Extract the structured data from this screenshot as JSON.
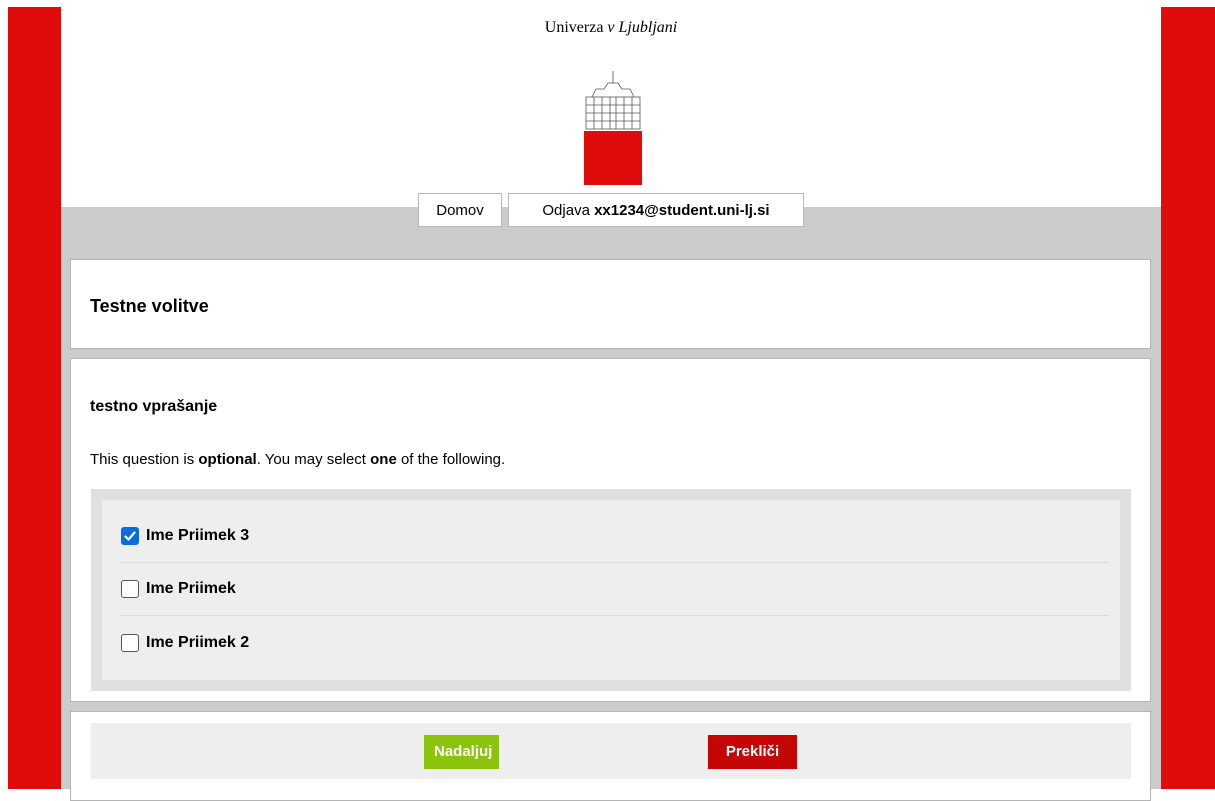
{
  "header": {
    "university_prefix": "Univerza",
    "university_italic": "v Ljubljani",
    "logo": "university-building-logo"
  },
  "nav": {
    "home_label": "Domov",
    "logout_label": "Odjava",
    "user_email": "xx1234@student.uni-lj.si"
  },
  "election": {
    "title": "Testne volitve"
  },
  "question": {
    "title": "testno vprašanje",
    "instructions": {
      "part1": "This question is ",
      "optional": "optional",
      "part2": ". You may select ",
      "count": "one",
      "part3": " of the following."
    },
    "options": [
      {
        "label": "Ime Priimek 3",
        "checked": true
      },
      {
        "label": "Ime Priimek",
        "checked": false
      },
      {
        "label": "Ime Priimek 2",
        "checked": false
      }
    ]
  },
  "actions": {
    "continue_label": "Nadaljuj",
    "cancel_label": "Prekliči"
  },
  "colors": {
    "brand_red": "#e00b0b",
    "continue_green": "#8cc30c",
    "cancel_red": "#c40606",
    "checkbox_blue": "#0b6cdb"
  }
}
